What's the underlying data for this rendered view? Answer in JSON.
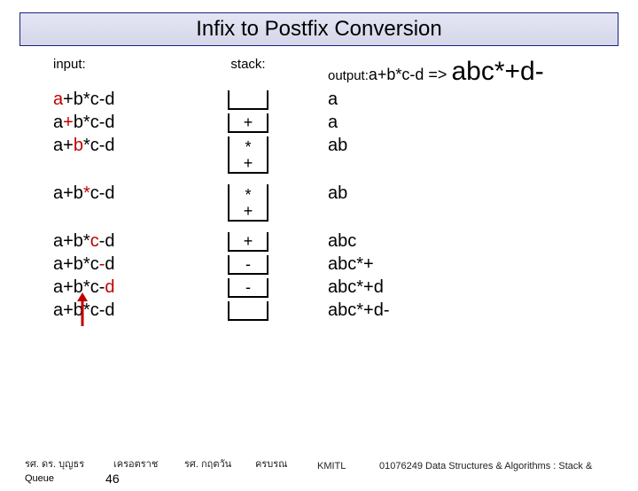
{
  "title": "Infix to Postfix Conversion",
  "labels": {
    "input": "input:",
    "stack": "stack:",
    "output": "output:"
  },
  "summary": {
    "expr": "a+b*c-d",
    "arrow": " => ",
    "result": "abc*+d-"
  },
  "steps": [
    {
      "input_pre": "",
      "input_hl": "a",
      "input_post": "+b*c-d",
      "stack": [],
      "height": "h1",
      "output": "a"
    },
    {
      "input_pre": "a",
      "input_hl": "+",
      "input_post": "b*c-d",
      "stack": [
        "+"
      ],
      "height": "h1",
      "output": "a"
    },
    {
      "input_pre": "a+",
      "input_hl": "b",
      "input_post": "*c-d",
      "stack": [
        "+",
        "*"
      ],
      "height": "h2",
      "output": "ab"
    },
    {
      "gap": true
    },
    {
      "input_pre": "a+b",
      "input_hl": "*",
      "input_post": "c-d",
      "stack": [
        "+",
        "*"
      ],
      "height": "h2",
      "output": "ab"
    },
    {
      "gap": true
    },
    {
      "input_pre": "a+b*",
      "input_hl": "c",
      "input_post": "-d",
      "stack": [
        "+"
      ],
      "height": "h1",
      "output": "abc"
    },
    {
      "input_pre": "a+b*c",
      "input_hl": "-",
      "input_post": "d",
      "stack": [
        "-"
      ],
      "height": "h1",
      "output": "abc*+"
    },
    {
      "input_pre": "a+b*c-",
      "input_hl": "d",
      "input_post": "",
      "stack": [
        "-"
      ],
      "height": "h1",
      "output": "abc*+d"
    },
    {
      "input_pre": "a+b*c-d",
      "input_hl": "",
      "input_post": "",
      "stack": [],
      "height": "h1",
      "output": "abc*+d-"
    }
  ],
  "footer": {
    "l1": "รศ. ดร. บุญธร",
    "l2": "เครอตราช",
    "m1": "รศ. กฤตวัน",
    "m2": "ครบรณ",
    "kmitl": "KMITL",
    "course": "01076249 Data Structures & Algorithms : Stack &",
    "queue": "Queue",
    "page": "46"
  }
}
